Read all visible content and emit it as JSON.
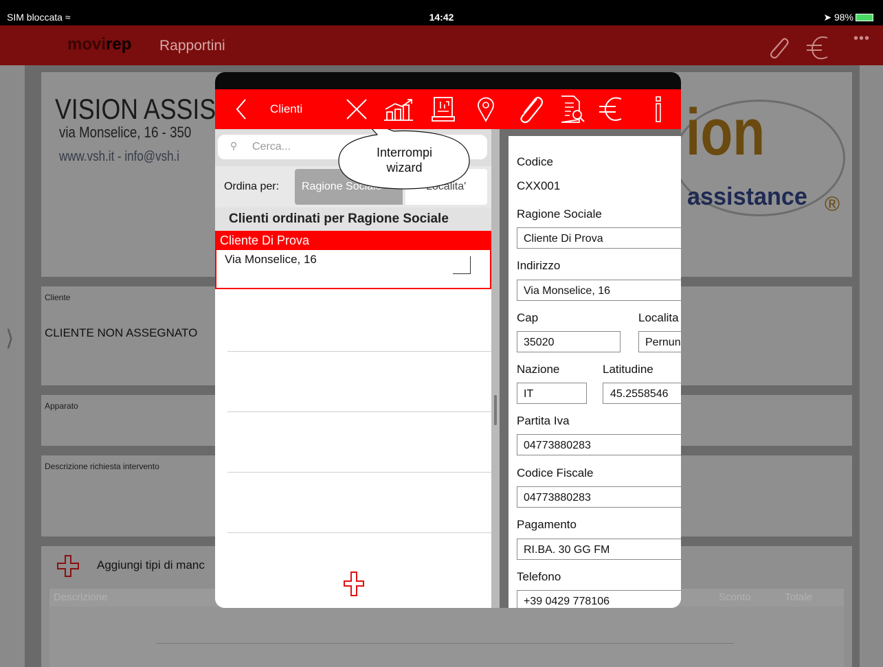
{
  "status_bar": {
    "carrier": "SIM bloccata",
    "time": "14:42",
    "battery": "98%"
  },
  "app": {
    "brand_part1": "movi",
    "brand_part2": "rep",
    "section": "Rapportini"
  },
  "background": {
    "company_name": "VISION ASSIST",
    "company_address": "via Monselice, 16 - 350",
    "company_web": "www.vsh.it - info@vsh.i",
    "logo_word": "ion",
    "logo_sub": "assistance",
    "logo_mark": "®",
    "cliente_label": "Cliente",
    "cliente_value": "CLIENTE NON ASSEGNATO",
    "apparato_label": "Apparato",
    "descrizione_label": "Descrizione richiesta intervento",
    "add_label": "Aggiungi tipi di manc",
    "table_headers": {
      "descrizione": "Descrizione",
      "sconto": "Sconto",
      "totale": "Totale"
    }
  },
  "modal": {
    "back_label": "Clienti",
    "search_placeholder": "Cerca...",
    "sort_label": "Ordina per:",
    "sort_options": [
      "Ragione Sociale",
      "Localita'"
    ],
    "list_header": "Clienti ordinati per Ragione Sociale",
    "selected_client": {
      "name": "Cliente Di Prova",
      "address": "Via Monselice, 16"
    },
    "callout_text": [
      "Interrompi",
      "wizard"
    ],
    "detail": {
      "codice_label": "Codice",
      "codice_value": "CXX001",
      "ragione_label": "Ragione Sociale",
      "ragione_value": "Cliente Di Prova",
      "indirizzo_label": "Indirizzo",
      "indirizzo_value": "Via Monselice, 16",
      "cap_label": "Cap",
      "cap_value": "35020",
      "localita_label": "Localita",
      "localita_value": "Pernun",
      "nazione_label": "Nazione",
      "nazione_value": "IT",
      "latitudine_label": "Latitudine",
      "latitudine_value": "45.2558546",
      "piva_label": "Partita Iva",
      "piva_value": "04773880283",
      "cf_label": "Codice Fiscale",
      "cf_value": "04773880283",
      "pagamento_label": "Pagamento",
      "pagamento_value": "RI.BA. 30 GG FM",
      "telefono_label": "Telefono",
      "telefono_value": "+39 0429 778106"
    }
  },
  "colors": {
    "toolbar_red": "#ff0000",
    "appbar_red": "#7a0d0d",
    "logo_gold": "#c98f1c"
  },
  "icons": [
    "back-chevron-icon",
    "close-x-icon",
    "chart-icon",
    "register-icon",
    "location-pin-icon",
    "paperclip-icon",
    "document-search-icon",
    "euro-icon",
    "info-icon",
    "add-plus-icon",
    "checkbox-icon"
  ]
}
